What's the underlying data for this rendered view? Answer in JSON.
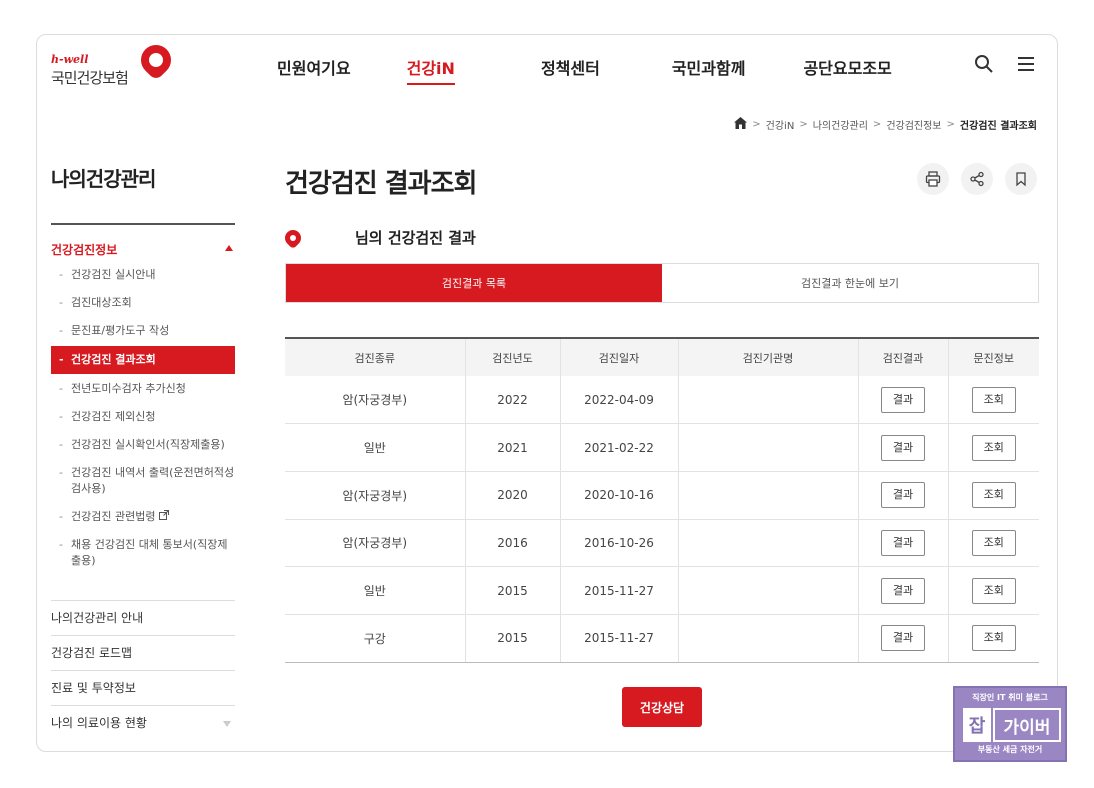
{
  "logo": {
    "tagline": "h-well",
    "name": "국민건강보험"
  },
  "gnb": [
    "민원여기요",
    "건강iN",
    "정책센터",
    "국민과함께",
    "공단요모조모"
  ],
  "gnb_active": 1,
  "breadcrumb": [
    "건강iN",
    "나의건강관리",
    "건강검진정보",
    "건강검진 결과조회"
  ],
  "sidebar": {
    "title": "나의건강관리",
    "section": "건강검진정보",
    "items": [
      "건강검진 실시안내",
      "검진대상조회",
      "문진표/평가도구 작성",
      "건강검진 결과조회",
      "전년도미수검자 추가신청",
      "건강검진 제외신청",
      "건강검진 실시확인서(직장제출용)",
      "건강검진 내역서 출력(운전면허적성검사용)",
      "건강검진 관련법령",
      "채용 건강검진 대체 통보서(직장제출용)"
    ],
    "active_index": 3,
    "bottom_items": [
      "나의건강관리 안내",
      "건강검진 로드맵",
      "진료 및 투약정보",
      "나의 의료이용 현황"
    ]
  },
  "page": {
    "title": "건강검진 결과조회",
    "result_heading": "님의 건강검진 결과",
    "tabs": [
      "검진결과 목록",
      "검진결과 한눈에 보기"
    ],
    "consult_button": "건강상담"
  },
  "table": {
    "headers": [
      "검진종류",
      "검진년도",
      "검진일자",
      "검진기관명",
      "검진결과",
      "문진정보"
    ],
    "rows": [
      {
        "type": "암(자궁경부)",
        "year": "2022",
        "date": "2022-04-09",
        "org": "",
        "result": "결과",
        "info": "조회"
      },
      {
        "type": "일반",
        "year": "2021",
        "date": "2021-02-22",
        "org": "",
        "result": "결과",
        "info": "조회"
      },
      {
        "type": "암(자궁경부)",
        "year": "2020",
        "date": "2020-10-16",
        "org": "",
        "result": "결과",
        "info": "조회"
      },
      {
        "type": "암(자궁경부)",
        "year": "2016",
        "date": "2016-10-26",
        "org": "",
        "result": "결과",
        "info": "조회"
      },
      {
        "type": "일반",
        "year": "2015",
        "date": "2015-11-27",
        "org": "",
        "result": "결과",
        "info": "조회"
      },
      {
        "type": "구강",
        "year": "2015",
        "date": "2015-11-27",
        "org": "",
        "result": "결과",
        "info": "조회"
      }
    ]
  },
  "watermark": {
    "top": "직장인 IT 취미 블로그",
    "logo_a": "잡",
    "logo_b": "가이버",
    "bottom": "부동산 세금 자전거"
  },
  "colors": {
    "accent": "#d71920",
    "watermark": "#9a86c2"
  }
}
